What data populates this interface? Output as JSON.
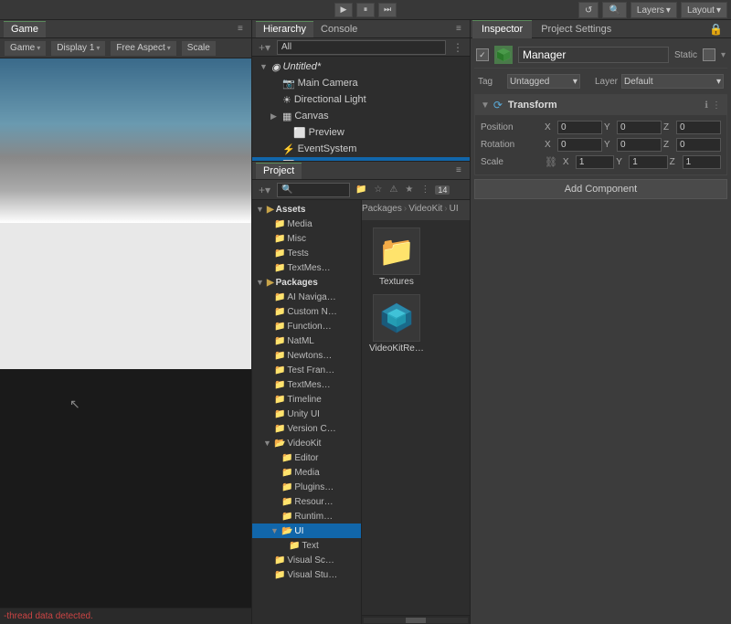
{
  "toolbar": {
    "play_label": "▶",
    "pause_label": "⏸",
    "step_label": "⏭",
    "layers_label": "Layers",
    "layout_label": "Layout",
    "undo_label": "↺",
    "search_label": "🔍"
  },
  "game_panel": {
    "tab_label": "Game",
    "display_label": "Display 1",
    "display_arrow": "▾",
    "aspect_label": "Free Aspect",
    "aspect_arrow": "▾",
    "scale_label": "Scale",
    "menu_icon": "≡",
    "error_text": "-thread data detected."
  },
  "hierarchy_panel": {
    "tab_label": "Hierarchy",
    "console_tab_label": "Console",
    "menu_icon": "≡",
    "add_icon": "+",
    "search_placeholder": "All",
    "items": [
      {
        "label": "Untitled*",
        "indent": 0,
        "icon": "◉",
        "has_arrow": true,
        "is_root": true
      },
      {
        "label": "Main Camera",
        "indent": 1,
        "icon": "📷",
        "has_arrow": false
      },
      {
        "label": "Directional Light",
        "indent": 1,
        "icon": "💡",
        "has_arrow": false
      },
      {
        "label": "Canvas",
        "indent": 1,
        "icon": "🗔",
        "has_arrow": true
      },
      {
        "label": "Preview",
        "indent": 2,
        "icon": "⬜",
        "has_arrow": false
      },
      {
        "label": "EventSystem",
        "indent": 1,
        "icon": "⚡",
        "has_arrow": false
      },
      {
        "label": "Manager",
        "indent": 1,
        "icon": "⬜",
        "has_arrow": false,
        "is_selected": true
      }
    ]
  },
  "project_panel": {
    "tab_label": "Project",
    "menu_icon": "≡",
    "add_label": "+▾",
    "search_placeholder": "🔍",
    "icon_btns": [
      "📁",
      "☆",
      "⚠",
      "★"
    ],
    "count_badge": "14",
    "breadcrumb": [
      "Packages",
      "VideoKit",
      "UI"
    ],
    "tree_items": [
      {
        "label": "Assets",
        "indent": 0,
        "has_arrow": true,
        "is_header": true
      },
      {
        "label": "Media",
        "indent": 1,
        "has_arrow": false
      },
      {
        "label": "Misc",
        "indent": 1,
        "has_arrow": false
      },
      {
        "label": "Tests",
        "indent": 1,
        "has_arrow": false
      },
      {
        "label": "TextMes…",
        "indent": 1,
        "has_arrow": false
      },
      {
        "label": "Packages",
        "indent": 0,
        "has_arrow": true,
        "is_header": true
      },
      {
        "label": "AI Naviga…",
        "indent": 1,
        "has_arrow": false
      },
      {
        "label": "Custom N…",
        "indent": 1,
        "has_arrow": false
      },
      {
        "label": "Function…",
        "indent": 1,
        "has_arrow": false
      },
      {
        "label": "NatML",
        "indent": 1,
        "has_arrow": false
      },
      {
        "label": "Newtons…",
        "indent": 1,
        "has_arrow": false
      },
      {
        "label": "Test Fran…",
        "indent": 1,
        "has_arrow": false
      },
      {
        "label": "TextMes…",
        "indent": 1,
        "has_arrow": false
      },
      {
        "label": "Timeline",
        "indent": 1,
        "has_arrow": false
      },
      {
        "label": "Unity UI",
        "indent": 1,
        "has_arrow": false
      },
      {
        "label": "Version C…",
        "indent": 1,
        "has_arrow": false
      },
      {
        "label": "VideoKit",
        "indent": 1,
        "has_arrow": true,
        "is_open": true
      },
      {
        "label": "Editor",
        "indent": 2,
        "has_arrow": false
      },
      {
        "label": "Media",
        "indent": 2,
        "has_arrow": false
      },
      {
        "label": "Plugins…",
        "indent": 2,
        "has_arrow": false
      },
      {
        "label": "Resour…",
        "indent": 2,
        "has_arrow": false
      },
      {
        "label": "Runtim…",
        "indent": 2,
        "has_arrow": false
      },
      {
        "label": "UI",
        "indent": 2,
        "has_arrow": true,
        "is_open": true,
        "is_selected": true
      },
      {
        "label": "Text",
        "indent": 3,
        "has_arrow": false
      },
      {
        "label": "Visual Sc…",
        "indent": 1,
        "has_arrow": false
      },
      {
        "label": "Visual Stu…",
        "indent": 1,
        "has_arrow": false
      }
    ],
    "content_items": [
      {
        "label": "Textures",
        "type": "folder"
      },
      {
        "label": "VideoKitRe…",
        "type": "cube"
      }
    ]
  },
  "inspector_panel": {
    "tab_label": "Inspector",
    "project_settings_label": "Project Settings",
    "object_name": "Manager",
    "object_checkbox": "✓",
    "static_label": "Static",
    "tag_label": "Tag",
    "tag_value": "Untagged",
    "layer_label": "Layer",
    "layer_value": "Default",
    "component_name": "Transform",
    "position_label": "Position",
    "rotation_label": "Rotation",
    "scale_label": "Scale",
    "x_label": "X",
    "y_label": "Y",
    "z_label": "Z",
    "position_x": "0",
    "position_y": "0",
    "position_z": "0",
    "rotation_x": "0",
    "rotation_y": "0",
    "rotation_z": "0",
    "scale_x": "1",
    "scale_y": "1",
    "scale_z": "1",
    "add_component_label": "Add Component"
  },
  "colors": {
    "accent_blue": "#1166aa",
    "unity_green": "#5a8a5a",
    "folder_yellow": "#c8a44a"
  }
}
